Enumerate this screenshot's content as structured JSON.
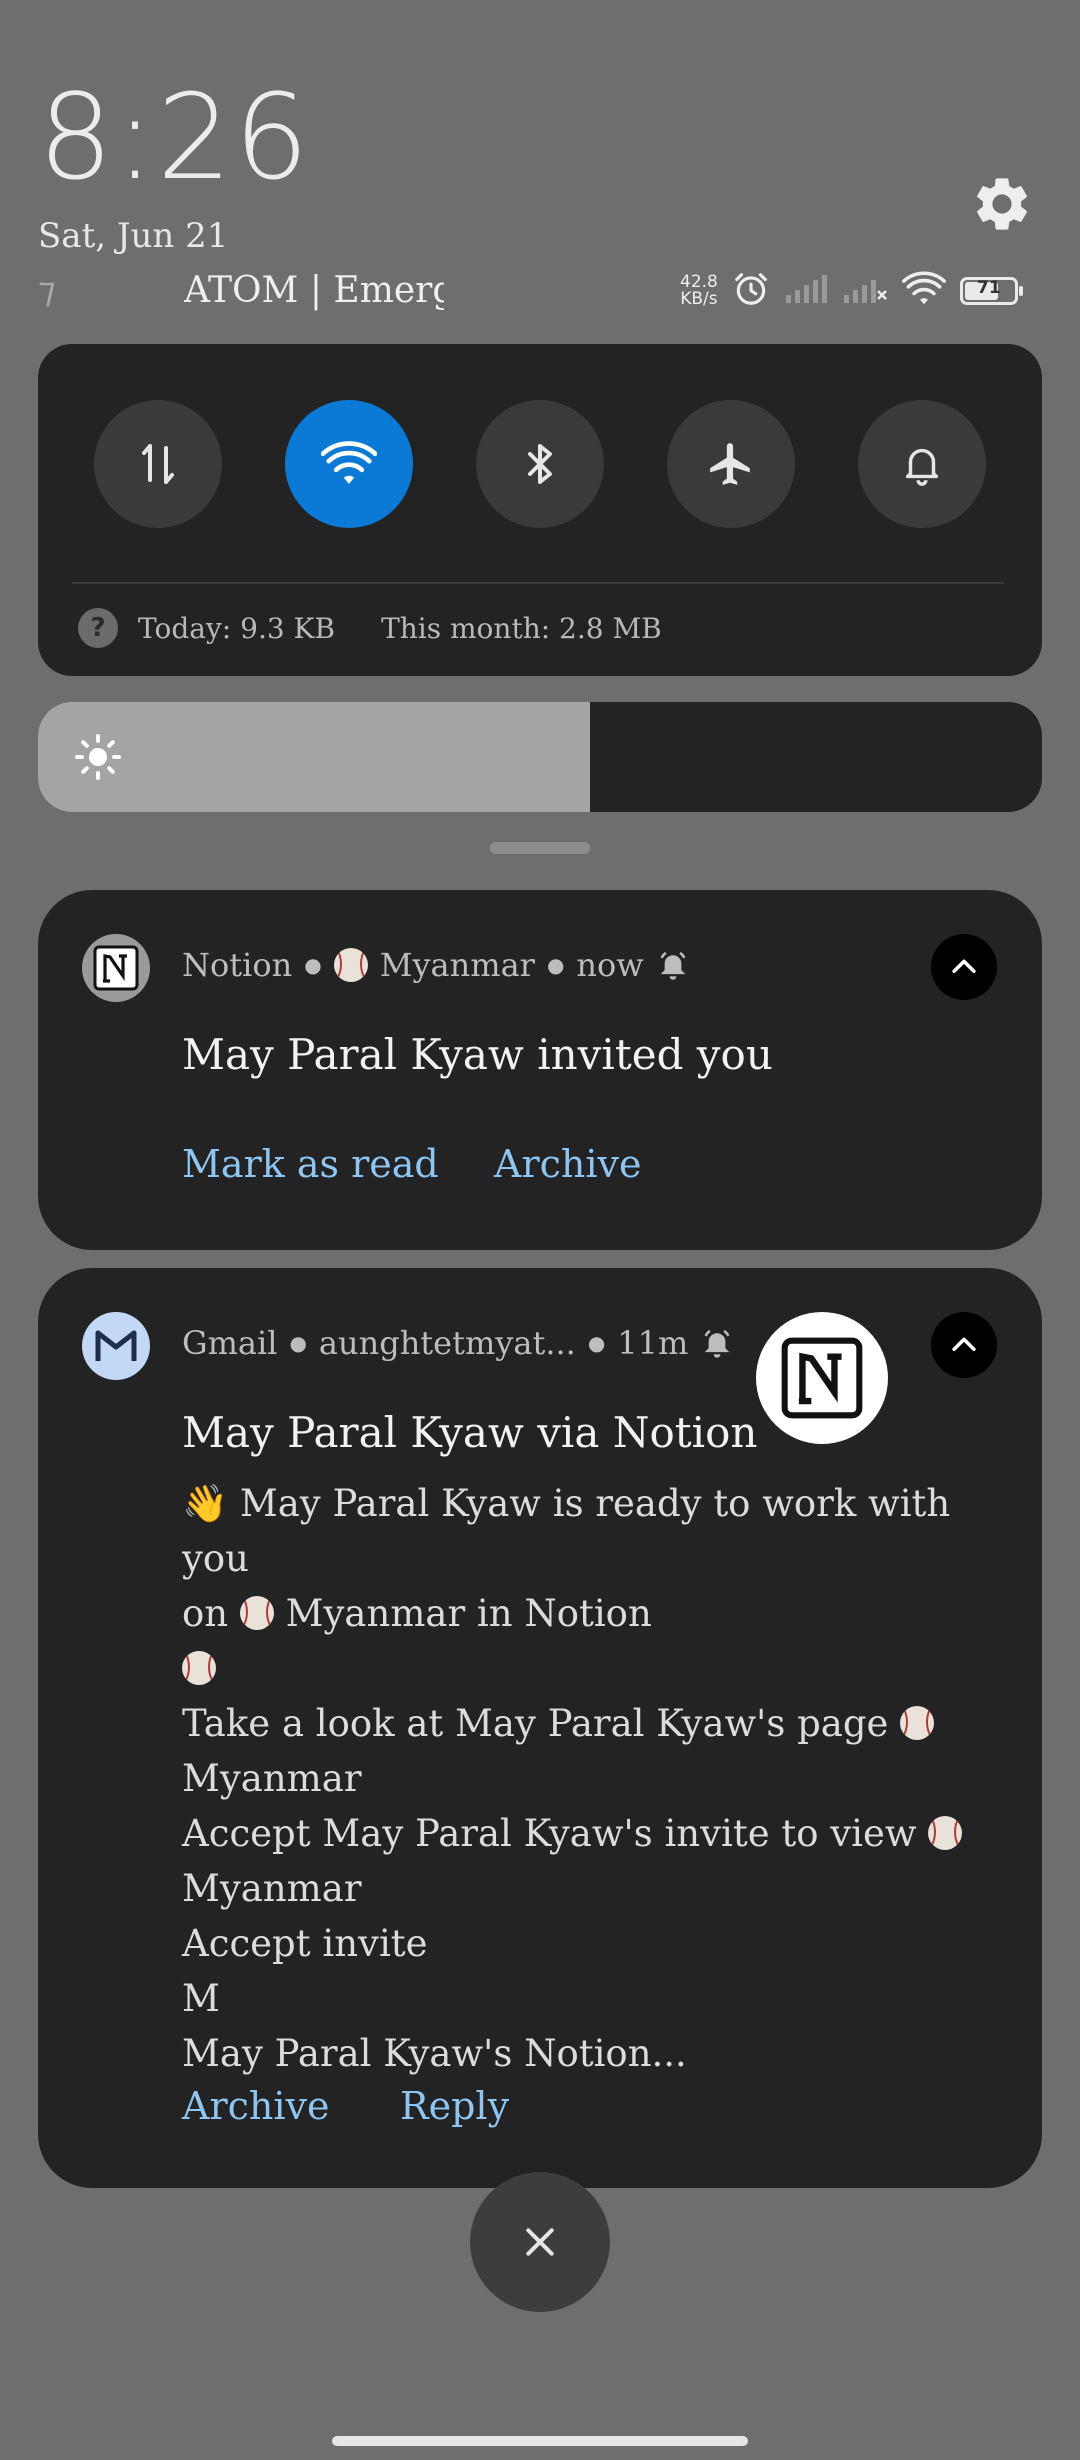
{
  "status": {
    "time": "8:26",
    "date": "Sat, Jun 21",
    "carrier_prefix": "⁊",
    "carrier": "ATOM | Emergency",
    "speed_value": "42.8",
    "speed_unit": "KB/s",
    "battery": "71",
    "battery_level": 0.71
  },
  "quick_settings": {
    "toggles": [
      {
        "name": "mobile-data",
        "active": false
      },
      {
        "name": "wifi",
        "active": true
      },
      {
        "name": "bluetooth",
        "active": false
      },
      {
        "name": "airplane-mode",
        "active": false
      },
      {
        "name": "notification-bell",
        "active": false
      }
    ],
    "data_today": "Today: 9.3 KB",
    "data_month": "This month: 2.8 MB",
    "help_glyph": "?",
    "brightness_level": 0.55,
    "accent_color": "#0a7ad6"
  },
  "notifications": [
    {
      "app": "Notion",
      "channel": "Myanmar",
      "time": "now",
      "title": "May Paral Kyaw invited you",
      "actions": [
        "Mark as read",
        "Archive"
      ]
    },
    {
      "app": "Gmail",
      "account": "aunghtetmyat...",
      "time": "11m",
      "title": "May Paral Kyaw via Notion",
      "body": {
        "line1": "👋 May Paral Kyaw is ready to work with you",
        "line2_a": "on",
        "line2_b": "Myanmar in Notion",
        "line4": "Take a look at May Paral Kyaw's page",
        "line5": "Myanmar",
        "line6": "Accept May Paral Kyaw's invite to view",
        "line7": "Myanmar",
        "line8": "Accept invite",
        "line9": "M",
        "line10": "May Paral Kyaw's Notion..."
      },
      "actions": [
        "Archive",
        "Reply"
      ]
    }
  ],
  "link_color": "#8ec6f3"
}
